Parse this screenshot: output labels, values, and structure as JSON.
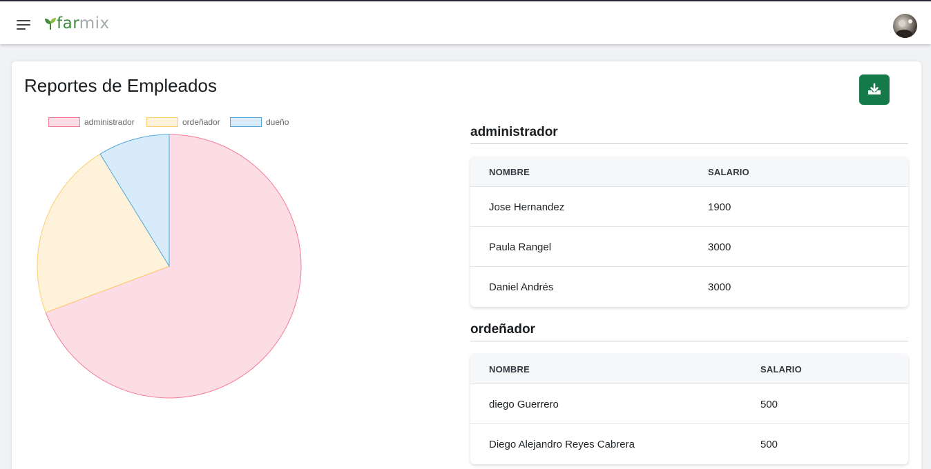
{
  "app": {
    "logo_part1": "far",
    "logo_part2": "mix"
  },
  "page": {
    "title": "Reportes de Empleados"
  },
  "icons": {
    "menu": "hamburger-menu-icon",
    "download": "download-tray-icon",
    "avatar": "user-avatar"
  },
  "colors": {
    "brand_green": "#147a4a",
    "logo_green": "#3f8a3c"
  },
  "chart_data": {
    "type": "pie",
    "categories": [
      "administrador",
      "ordeñador",
      "dueño"
    ],
    "values": [
      7900,
      2500,
      1000
    ],
    "legend": "top-left",
    "colors": {
      "fill": [
        "#fddde5",
        "#fff2da",
        "#d8ebfa"
      ],
      "stroke": [
        "#f47c96",
        "#ffcd6d",
        "#4fa8dd"
      ]
    }
  },
  "sections": [
    {
      "title": "administrador",
      "headers": [
        "NOMBRE",
        "SALARIO"
      ],
      "rows": [
        [
          "Jose Hernandez",
          "1900"
        ],
        [
          "Paula Rangel",
          "3000"
        ],
        [
          "Daniel Andrés",
          "3000"
        ]
      ]
    },
    {
      "title": "ordeñador",
      "headers": [
        "NOMBRE",
        "SALARIO"
      ],
      "rows": [
        [
          "diego Guerrero",
          "500"
        ],
        [
          "Diego Alejandro Reyes Cabrera",
          "500"
        ]
      ]
    }
  ]
}
